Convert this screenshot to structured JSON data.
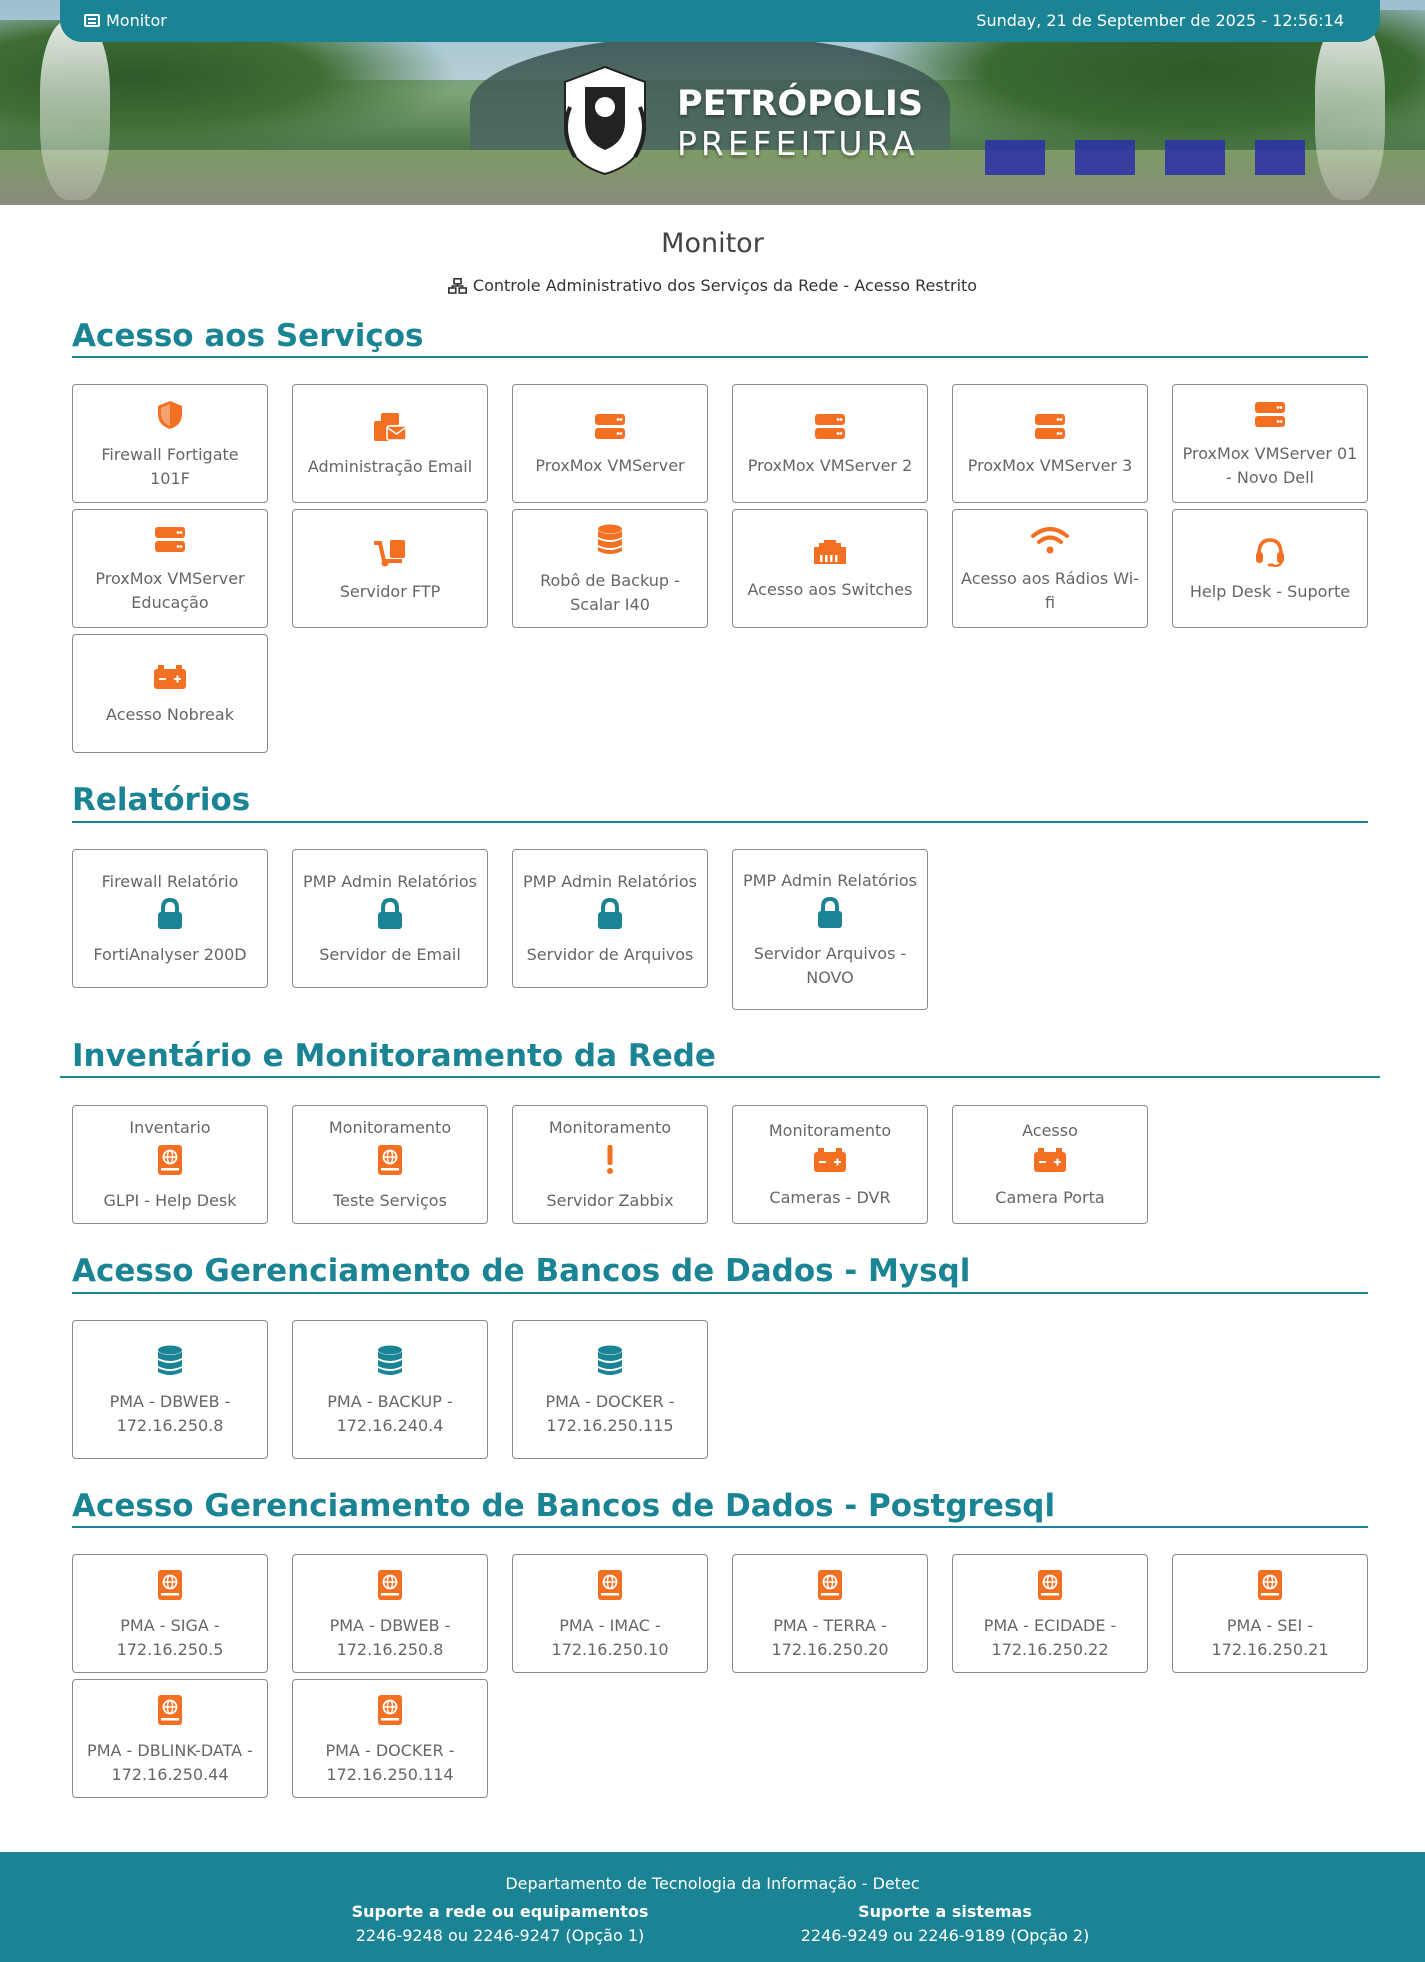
{
  "topbar": {
    "brand": "Monitor",
    "clock": "Sunday, 21 de September de 2025 - 12:56:14"
  },
  "logo": {
    "line1": "PETRÓPOLIS",
    "line2": "PREFEITURA"
  },
  "page": {
    "title": "Monitor",
    "subtitle": "Controle Administrativo dos Serviços da Rede - Acesso Restrito"
  },
  "sections": {
    "servicos": {
      "title": "Acesso aos Serviços",
      "items": [
        {
          "label": "Firewall Fortigate 101F",
          "icon": "shield-icon"
        },
        {
          "label": "Administração Email",
          "icon": "mail-bulk-icon"
        },
        {
          "label": "ProxMox VMServer",
          "icon": "server-icon"
        },
        {
          "label": "ProxMox VMServer 2",
          "icon": "server-icon"
        },
        {
          "label": "ProxMox VMServer 3",
          "icon": "server-icon"
        },
        {
          "label": "ProxMox VMServer 01 - Novo Dell",
          "icon": "server-icon"
        },
        {
          "label": "ProxMox VMServer Educação",
          "icon": "server-icon"
        },
        {
          "label": "Servidor FTP",
          "icon": "dolly-icon"
        },
        {
          "label": "Robô de Backup - Scalar I40",
          "icon": "database-icon"
        },
        {
          "label": "Acesso aos Switches",
          "icon": "ethernet-icon"
        },
        {
          "label": "Acesso aos Rádios Wi-fi",
          "icon": "wifi-icon"
        },
        {
          "label": "Help Desk - Suporte",
          "icon": "headset-icon"
        },
        {
          "label": "Acesso Nobreak",
          "icon": "battery-icon"
        }
      ]
    },
    "relatorios": {
      "title": "Relatórios",
      "items": [
        {
          "top": "Firewall Relatório",
          "bottom": "FortiAnalyser 200D",
          "icon": "lock-icon"
        },
        {
          "top": "PMP Admin Relatórios",
          "bottom": "Servidor de Email",
          "icon": "lock-icon"
        },
        {
          "top": "PMP Admin Relatórios",
          "bottom": "Servidor de Arquivos",
          "icon": "lock-icon"
        },
        {
          "top": "PMP Admin Relatórios",
          "bottom": "Servidor Arquivos - NOVO",
          "icon": "lock-icon"
        }
      ]
    },
    "inventario": {
      "title": "Inventário e Monitoramento da Rede",
      "items": [
        {
          "top": "Inventario",
          "bottom": "GLPI - Help Desk",
          "icon": "atlas-icon"
        },
        {
          "top": "Monitoramento",
          "bottom": "Teste Serviços",
          "icon": "atlas-icon"
        },
        {
          "top": "Monitoramento",
          "bottom": "Servidor Zabbix",
          "icon": "exclamation-icon"
        },
        {
          "top": "Monitoramento",
          "bottom": "Cameras - DVR",
          "icon": "battery-icon"
        },
        {
          "top": "Acesso",
          "bottom": "Camera Porta",
          "icon": "battery-icon"
        }
      ]
    },
    "mysql": {
      "title": "Acesso Gerenciamento de Bancos de Dados - Mysql",
      "items": [
        {
          "label": "PMA - DBWEB - 172.16.250.8",
          "icon": "database-icon"
        },
        {
          "label": "PMA - BACKUP - 172.16.240.4",
          "icon": "database-icon"
        },
        {
          "label": "PMA - DOCKER - 172.16.250.115",
          "icon": "database-icon"
        }
      ]
    },
    "postgres": {
      "title": "Acesso Gerenciamento de Bancos de Dados - Postgresql",
      "items": [
        {
          "label": "PMA - SIGA - 172.16.250.5",
          "icon": "atlas-icon"
        },
        {
          "label": "PMA - DBWEB - 172.16.250.8",
          "icon": "atlas-icon"
        },
        {
          "label": "PMA - IMAC - 172.16.250.10",
          "icon": "atlas-icon"
        },
        {
          "label": "PMA - TERRA - 172.16.250.20",
          "icon": "atlas-icon"
        },
        {
          "label": "PMA - ECIDADE - 172.16.250.22",
          "icon": "atlas-icon"
        },
        {
          "label": "PMA - SEI - 172.16.250.21",
          "icon": "atlas-icon"
        },
        {
          "label": "PMA - DBLINK-DATA - 172.16.250.44",
          "icon": "atlas-icon"
        },
        {
          "label": "PMA - DOCKER - 172.16.250.114",
          "icon": "atlas-icon"
        }
      ]
    }
  },
  "footer": {
    "dept": "Departamento de Tecnologia da Informação - Detec",
    "col1_head": "Suporte a rede ou equipamentos",
    "col1_phones": "2246-9248 ou 2246-9247 (Opção 1)",
    "col2_head": "Suporte a sistemas",
    "col2_phones": "2246-9249 ou 2246-9189 (Opção 2)"
  },
  "colors": {
    "accent": "#1b8494",
    "orange": "#f36f21",
    "teal_icon": "#1b8494"
  }
}
